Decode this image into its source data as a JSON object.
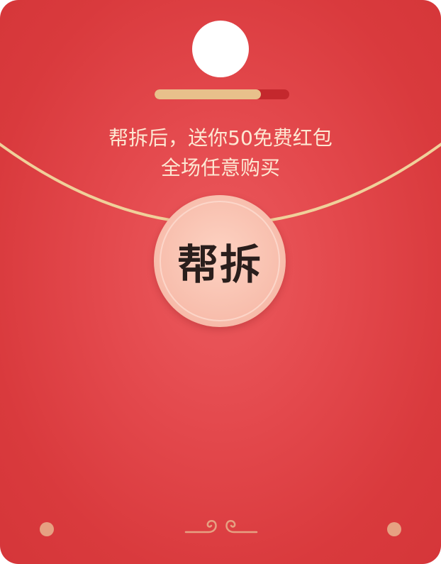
{
  "envelope": {
    "headline_line1": "帮拆后，送你50免费红包",
    "headline_line2": "全场任意购买",
    "open_button_label": "帮拆",
    "progress": 0.79
  },
  "colors": {
    "envelope_red": "#e3484c",
    "progress_fill": "#e8c08b",
    "progress_track": "#c4282d",
    "string_gold": "#f0d09a",
    "button_pink": "#f8bfae",
    "dot_color": "#e6a182",
    "headline_text": "#fde8d3"
  },
  "icons": {
    "decoration": "auspicious-cloud-icon"
  }
}
